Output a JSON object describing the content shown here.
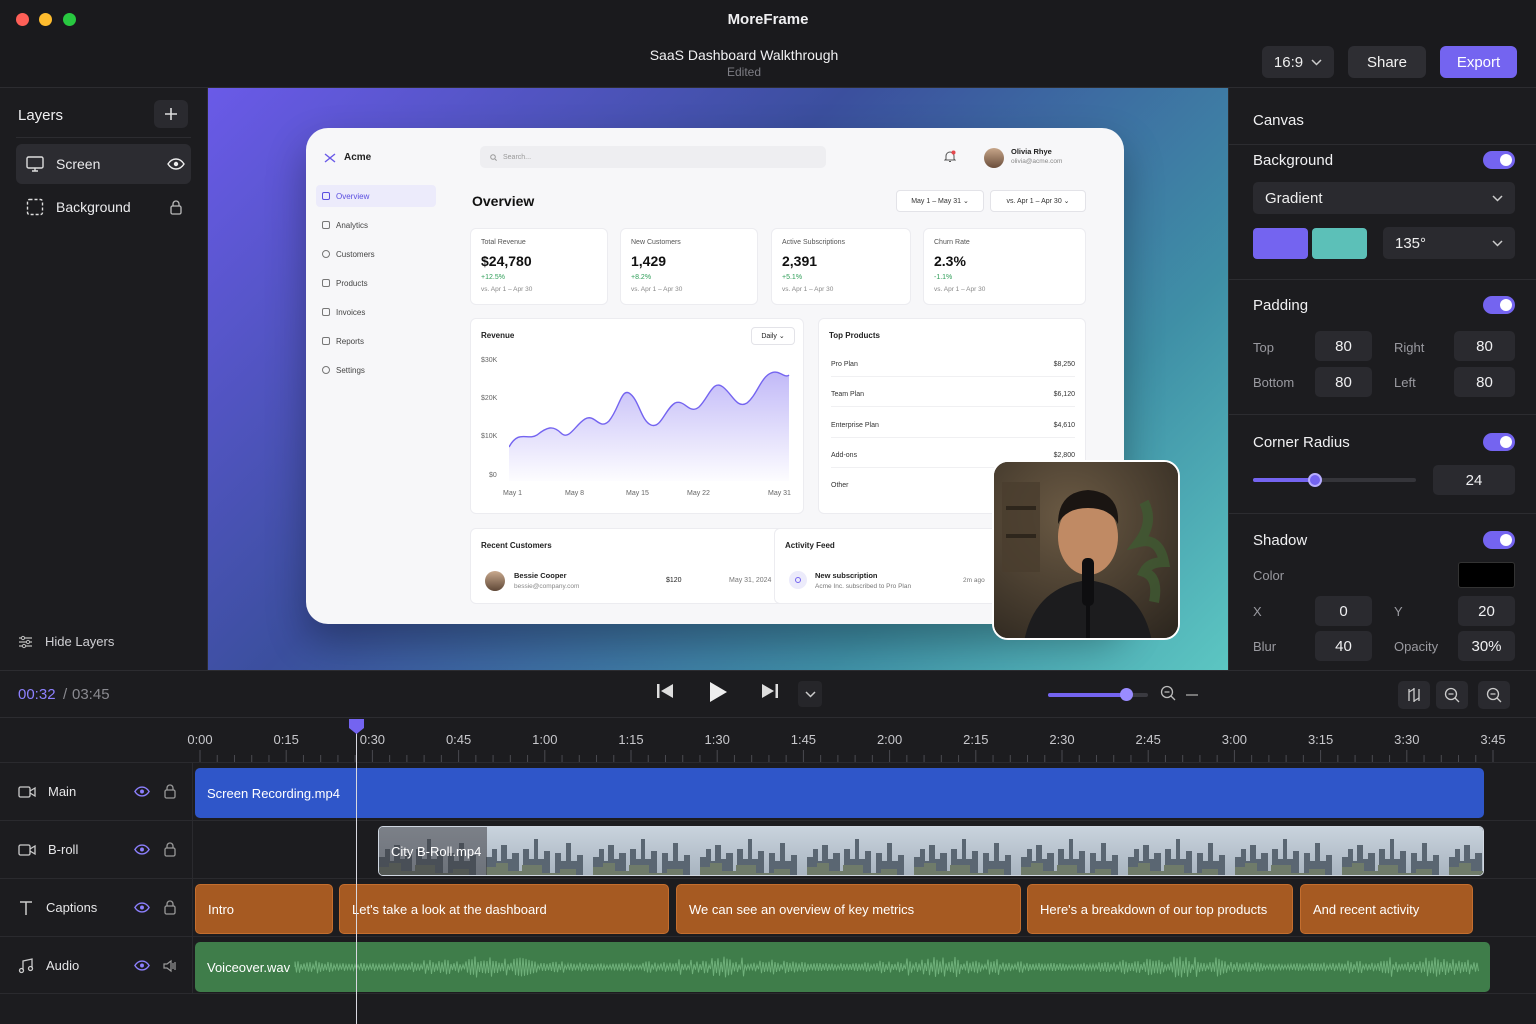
{
  "app": {
    "title": "MoreFrame"
  },
  "document": {
    "title": "SaaS Dashboard Walkthrough",
    "status": "Edited"
  },
  "toolbar": {
    "aspect_ratio": "16:9",
    "share_label": "Share",
    "export_label": "Export"
  },
  "layers": {
    "title": "Layers",
    "items": [
      {
        "label": "Screen",
        "icon": "monitor-icon",
        "state": "visible"
      },
      {
        "label": "Background",
        "icon": "dashed-square-icon",
        "state": "locked"
      }
    ],
    "hide_label": "Hide Layers"
  },
  "preview": {
    "brand": "Acme",
    "search_placeholder": "Search...",
    "user": {
      "name": "Olivia Rhye",
      "email": "olivia@acme.com"
    },
    "nav": [
      "Overview",
      "Analytics",
      "Customers",
      "Products",
      "Invoices",
      "Reports",
      "Settings"
    ],
    "page_title": "Overview",
    "date_range": "May 1 – May 31",
    "compare_range": "vs. Apr 1 – Apr 30",
    "kpis": [
      {
        "label": "Total Revenue",
        "value": "$24,780",
        "delta": "+12.5%",
        "compare": "vs. Apr 1 – Apr 30"
      },
      {
        "label": "New Customers",
        "value": "1,429",
        "delta": "+8.2%",
        "compare": "vs. Apr 1 – Apr 30"
      },
      {
        "label": "Active Subscriptions",
        "value": "2,391",
        "delta": "+5.1%",
        "compare": "vs. Apr 1 – Apr 30"
      },
      {
        "label": "Churn Rate",
        "value": "2.3%",
        "delta": "-1.1%",
        "compare": "vs. Apr 1 – Apr 30"
      }
    ],
    "revenue": {
      "title": "Revenue",
      "granularity": "Daily",
      "y_ticks": [
        "$30K",
        "$20K",
        "$10K",
        "$0"
      ],
      "x_ticks": [
        "May 1",
        "May 8",
        "May 15",
        "May 22",
        "May 31"
      ]
    },
    "top_products": {
      "title": "Top Products",
      "rows": [
        {
          "name": "Pro Plan",
          "value": "$8,250"
        },
        {
          "name": "Team Plan",
          "value": "$6,120"
        },
        {
          "name": "Enterprise Plan",
          "value": "$4,610"
        },
        {
          "name": "Add-ons",
          "value": "$2,800"
        },
        {
          "name": "Other",
          "value": ""
        }
      ]
    },
    "recent_customers": {
      "title": "Recent Customers",
      "name": "Bessie Cooper",
      "email": "bessie@company.com",
      "amount": "$120",
      "date": "May 31, 2024"
    },
    "activity": {
      "title": "Activity Feed",
      "event": "New subscription",
      "detail": "Acme Inc. subscribed to Pro Plan",
      "time": "2m ago"
    }
  },
  "inspector": {
    "title": "Canvas",
    "background": {
      "label": "Background",
      "enabled": true,
      "type": "Gradient",
      "color_a": "#7464f0",
      "color_b": "#5cc0b8",
      "angle": "135°"
    },
    "padding": {
      "label": "Padding",
      "enabled": true,
      "top_label": "Top",
      "top": "80",
      "right_label": "Right",
      "right": "80",
      "bottom_label": "Bottom",
      "bottom": "80",
      "left_label": "Left",
      "left": "80"
    },
    "corner_radius": {
      "label": "Corner Radius",
      "enabled": true,
      "value": "24",
      "slider_fraction": 0.38
    },
    "shadow": {
      "label": "Shadow",
      "enabled": true,
      "color_label": "Color",
      "color": "#000000",
      "x_label": "X",
      "x": "0",
      "y_label": "Y",
      "y": "20",
      "blur_label": "Blur",
      "blur": "40",
      "opacity_label": "Opacity",
      "opacity": "30%"
    }
  },
  "transport": {
    "current_time": "00:32",
    "separator": "/",
    "total_time": "03:45",
    "zoom_fraction": 0.78
  },
  "timeline": {
    "ruler": [
      "0:00",
      "0:15",
      "0:30",
      "0:45",
      "1:00",
      "1:15",
      "1:30",
      "1:45",
      "2:00",
      "2:15",
      "2:30",
      "2:45",
      "3:00",
      "3:15",
      "3:30",
      "3:45"
    ],
    "tracks": [
      {
        "name": "Main",
        "icon": "video-icon",
        "clips": [
          "Screen Recording.mp4"
        ]
      },
      {
        "name": "B-roll",
        "icon": "video-icon",
        "clips": [
          "City B-Roll.mp4"
        ]
      },
      {
        "name": "Captions",
        "icon": "text-icon",
        "clips": [
          "Intro",
          "Let's take a look at the dashboard",
          "We can see an overview of key metrics",
          "Here's a breakdown of our top products",
          "And recent activity"
        ]
      },
      {
        "name": "Audio",
        "icon": "music-icon",
        "clips": [
          "Voiceover.wav"
        ]
      }
    ]
  }
}
